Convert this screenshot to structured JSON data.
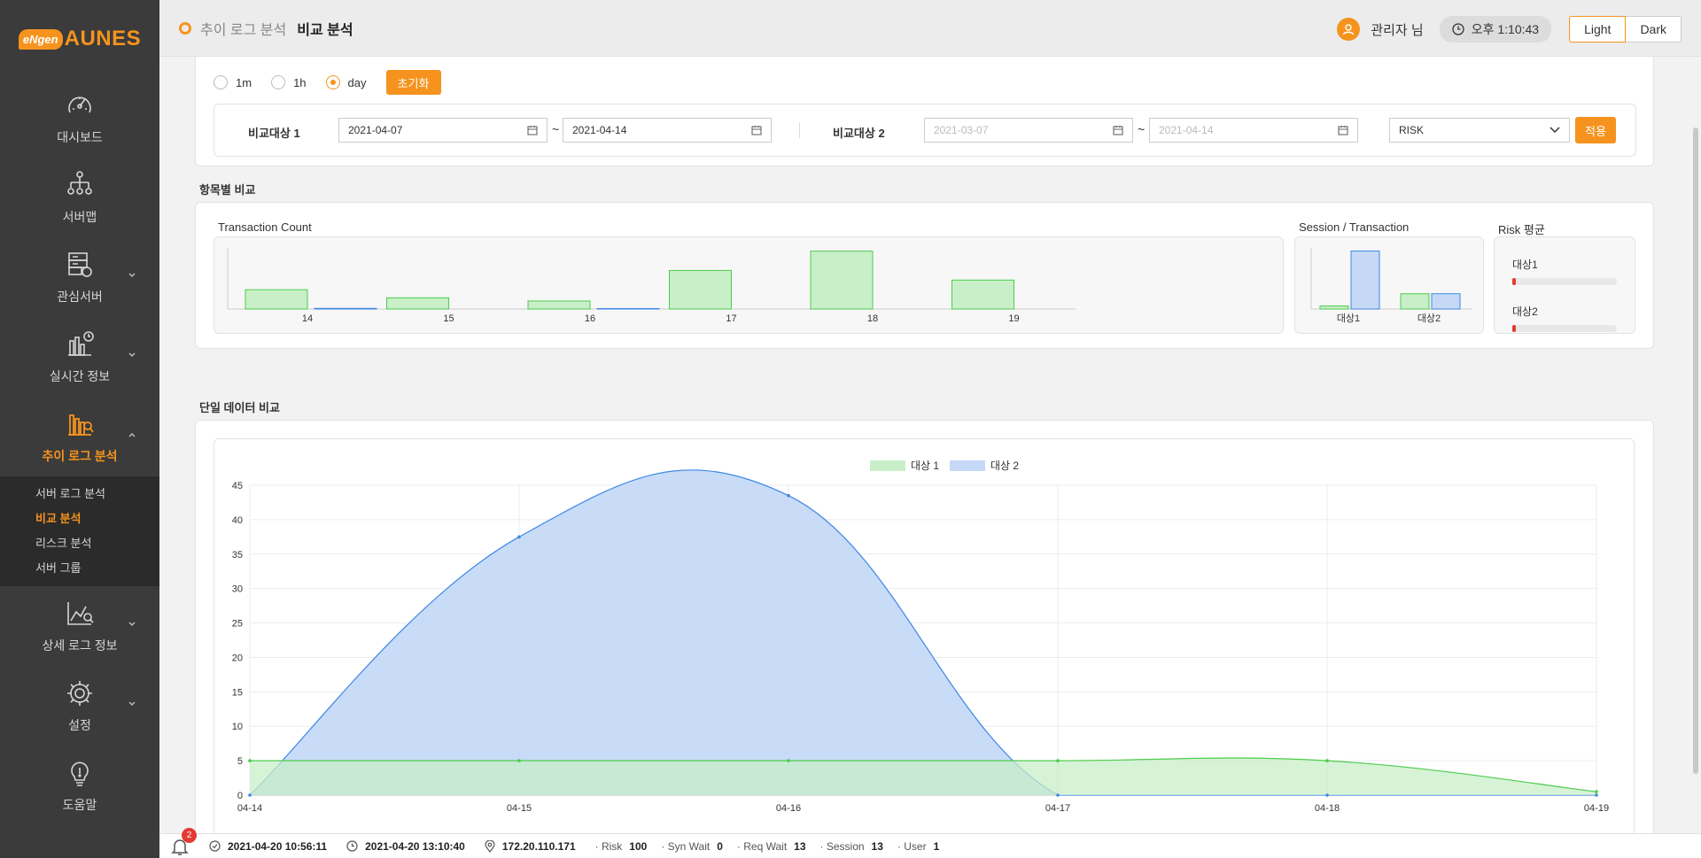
{
  "logo": {
    "badge": "eNgen",
    "name": "AUNES"
  },
  "nav": [
    {
      "label": "대시보드",
      "icon": "dashboard-gauge-icon"
    },
    {
      "label": "서버맵",
      "icon": "server-map-icon"
    },
    {
      "label": "관심서버",
      "icon": "watch-server-icon"
    },
    {
      "label": "실시간 정보",
      "icon": "realtime-chart-icon"
    },
    {
      "label": "추이 로그 분석",
      "icon": "trend-log-icon"
    },
    {
      "label": "상세 로그 정보",
      "icon": "detail-log-icon"
    },
    {
      "label": "설정",
      "icon": "gear-icon"
    },
    {
      "label": "도움말",
      "icon": "lightbulb-icon"
    }
  ],
  "submenu": [
    "서버 로그 분석",
    "비교 분석",
    "리스크 분석",
    "서버 그룹"
  ],
  "header": {
    "crumb_parent": "추이 로그 분석",
    "crumb_current": "비교 분석",
    "user": "관리자 님",
    "time": "오후 1:10:43",
    "theme_light": "Light",
    "theme_dark": "Dark"
  },
  "filter": {
    "radios": [
      "1m",
      "1h",
      "day"
    ],
    "selected": "day",
    "reset": "초기화",
    "target1_label": "비교대상 1",
    "target1_from": "2021-04-07",
    "target1_to": "2021-04-14",
    "tilde": "~",
    "target2_label": "비교대상 2",
    "target2_from": "2021-03-07",
    "target2_to": "2021-04-14",
    "metric": "RISK",
    "apply": "적용"
  },
  "section1": {
    "title": "항목별 비교",
    "tx_title": "Transaction Count",
    "st_title": "Session / Transaction",
    "risk_title": "Risk 평균",
    "risk1_label": "대상1",
    "risk2_label": "대상2"
  },
  "section2": {
    "title": "단일 데이터 비교",
    "legend1": "대상 1",
    "legend2": "대상 2"
  },
  "colors": {
    "accent": "#f5931e",
    "series1_fill": "#c8efc8",
    "series1_line": "#4ccc4c",
    "series2_fill": "#c5d9f7",
    "series2_line": "#3f87e6",
    "risk": "#e53935"
  },
  "chart_data": [
    {
      "type": "bar",
      "title": "Transaction Count",
      "categories": [
        "14",
        "15",
        "16",
        "17",
        "18",
        "19"
      ],
      "series": [
        {
          "values": [
            12,
            7,
            5,
            24,
            36,
            18
          ]
        },
        {
          "values": [
            0.4,
            0,
            0.3,
            0,
            0,
            0
          ]
        }
      ]
    },
    {
      "type": "bar",
      "title": "Session / Transaction",
      "categories": [
        "대상1",
        "대상2"
      ],
      "series": [
        {
          "values": [
            2,
            10
          ]
        },
        {
          "values": [
            38,
            10
          ]
        }
      ]
    },
    {
      "type": "bar",
      "title": "Risk 평균",
      "categories": [
        "대상1",
        "대상2"
      ],
      "values": [
        0.02,
        0.02
      ]
    },
    {
      "type": "area",
      "x": [
        "04-14",
        "04-15",
        "04-16",
        "04-17",
        "04-18",
        "04-19"
      ],
      "series": [
        {
          "name": "대상 1",
          "values": [
            5,
            5,
            5,
            5,
            5,
            0.5
          ]
        },
        {
          "name": "대상 2",
          "values": [
            0,
            37.5,
            43.5,
            0,
            0,
            0
          ]
        }
      ],
      "ylim": [
        0,
        45
      ],
      "yticks": [
        0,
        5,
        10,
        15,
        20,
        25,
        30,
        35,
        40,
        45
      ],
      "legend": "top-center",
      "grid": true
    }
  ],
  "footer": {
    "alerts": "2",
    "start_time": "2021-04-20 10:56:11",
    "end_time": "2021-04-20 13:10:40",
    "ip": "172.20.110.171",
    "stats": [
      {
        "label": "· Risk",
        "value": "100"
      },
      {
        "label": "· Syn Wait",
        "value": "0"
      },
      {
        "label": "· Req Wait",
        "value": "13"
      },
      {
        "label": "· Session",
        "value": "13"
      },
      {
        "label": "· User",
        "value": "1"
      }
    ]
  }
}
